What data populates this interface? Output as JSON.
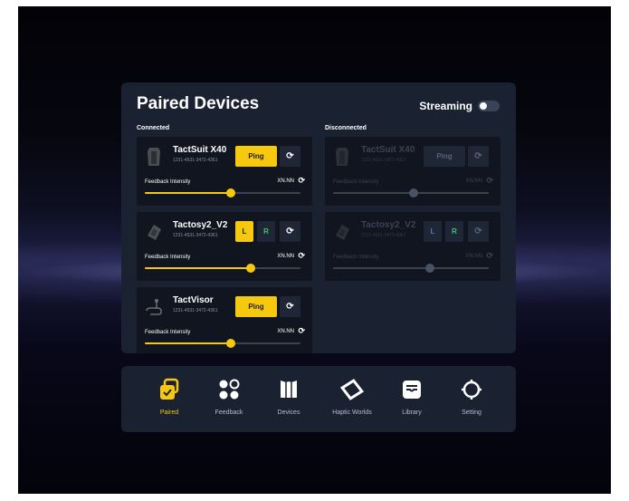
{
  "panel": {
    "title": "Paired Devices",
    "streaming_label": "Streaming",
    "streaming_on": false,
    "connected_label": "Connected",
    "disconnected_label": "Disconnected"
  },
  "connected": [
    {
      "name": "TactSuit X40",
      "serial": "1231-4531-3472-4361",
      "action": "Ping",
      "feedback_label": "Feedback Intensity",
      "value": "XN.NN",
      "intensity": 0.55
    },
    {
      "name": "Tactosy2_V2",
      "serial": "1231-4531-3472-4361",
      "left": "L",
      "right": "R",
      "feedback_label": "Feedback Intensity",
      "value": "XN.NN",
      "intensity": 0.68
    },
    {
      "name": "TactVisor",
      "serial": "1231-4531-3472-4361",
      "action": "Ping",
      "feedback_label": "Feedback Intensity",
      "value": "XN.NN",
      "intensity": 0.55
    }
  ],
  "disconnected": [
    {
      "name": "TactSuit X40",
      "serial": "1231-4531-3472-4361",
      "action": "Ping",
      "feedback_label": "Feedback Intensity",
      "value": "XN.NN",
      "intensity": 0.52
    },
    {
      "name": "Tactosy2_V2",
      "serial": "1231-4531-3472-4361",
      "left": "L",
      "right": "R",
      "feedback_label": "Feedback Intensity",
      "value": "XN.NN",
      "intensity": 0.62
    }
  ],
  "nav": [
    {
      "label": "Paired",
      "icon": "paired-icon",
      "active": true
    },
    {
      "label": "Feedback",
      "icon": "feedback-icon",
      "active": false
    },
    {
      "label": "Devices",
      "icon": "devices-icon",
      "active": false
    },
    {
      "label": "Haptic Worlds",
      "icon": "haptic-worlds-icon",
      "active": false
    },
    {
      "label": "Library",
      "icon": "library-icon",
      "active": false
    },
    {
      "label": "Setting",
      "icon": "setting-icon",
      "active": false
    }
  ],
  "colors": {
    "accent": "#f6c90e",
    "panel": "#1a2131",
    "card": "#10151f",
    "green": "#3ec46d",
    "blue": "#3b82c4"
  }
}
